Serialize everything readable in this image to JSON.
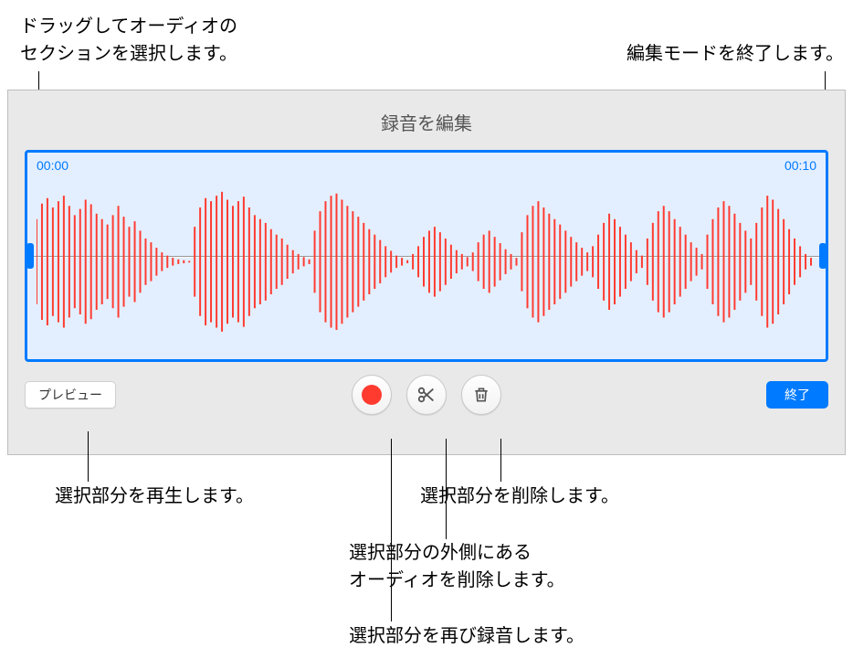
{
  "callouts": {
    "drag_select": "ドラッグしてオーディオの\nセクションを選択します。",
    "exit_edit": "編集モードを終了します。",
    "play_selection": "選択部分を再生します。",
    "delete_selection": "選択部分を削除します。",
    "trim_outside": "選択部分の外側にある\nオーディオを削除します。",
    "rerecord": "選択部分を再び録音します。"
  },
  "panel": {
    "title": "録音を編集",
    "time_start": "00:00",
    "time_end": "00:10"
  },
  "toolbar": {
    "preview_label": "プレビュー",
    "done_label": "終了"
  },
  "colors": {
    "accent": "#007aff",
    "record": "#ff3b30",
    "panel_bg": "#e9e9e9",
    "waveform": "#ff3b30"
  },
  "chart_data": {
    "type": "waveform",
    "duration_sec": 10,
    "sample_amplitudes": [
      0.55,
      0.75,
      0.82,
      0.7,
      0.78,
      0.85,
      0.72,
      0.6,
      0.68,
      0.8,
      0.74,
      0.62,
      0.55,
      0.48,
      0.6,
      0.72,
      0.58,
      0.45,
      0.52,
      0.4,
      0.3,
      0.25,
      0.18,
      0.12,
      0.08,
      0.05,
      0.03,
      0.02,
      0.01,
      0.45,
      0.7,
      0.82,
      0.78,
      0.85,
      0.9,
      0.8,
      0.72,
      0.78,
      0.84,
      0.7,
      0.6,
      0.55,
      0.5,
      0.42,
      0.35,
      0.3,
      0.22,
      0.15,
      0.1,
      0.06,
      0.03,
      0.4,
      0.65,
      0.78,
      0.85,
      0.88,
      0.8,
      0.72,
      0.65,
      0.58,
      0.5,
      0.42,
      0.35,
      0.28,
      0.2,
      0.14,
      0.08,
      0.05,
      0.02,
      0.1,
      0.2,
      0.32,
      0.4,
      0.45,
      0.38,
      0.3,
      0.22,
      0.15,
      0.1,
      0.06,
      0.12,
      0.25,
      0.35,
      0.4,
      0.32,
      0.24,
      0.16,
      0.1,
      0.05,
      0.38,
      0.6,
      0.72,
      0.78,
      0.7,
      0.62,
      0.55,
      0.48,
      0.4,
      0.32,
      0.25,
      0.18,
      0.12,
      0.2,
      0.35,
      0.5,
      0.62,
      0.55,
      0.45,
      0.35,
      0.25,
      0.15,
      0.08,
      0.3,
      0.5,
      0.65,
      0.72,
      0.65,
      0.55,
      0.45,
      0.35,
      0.25,
      0.18,
      0.1,
      0.35,
      0.55,
      0.7,
      0.78,
      0.72,
      0.62,
      0.5,
      0.4,
      0.3,
      0.5,
      0.7,
      0.85,
      0.8,
      0.68,
      0.55,
      0.42,
      0.3,
      0.2,
      0.1,
      0.05
    ]
  }
}
